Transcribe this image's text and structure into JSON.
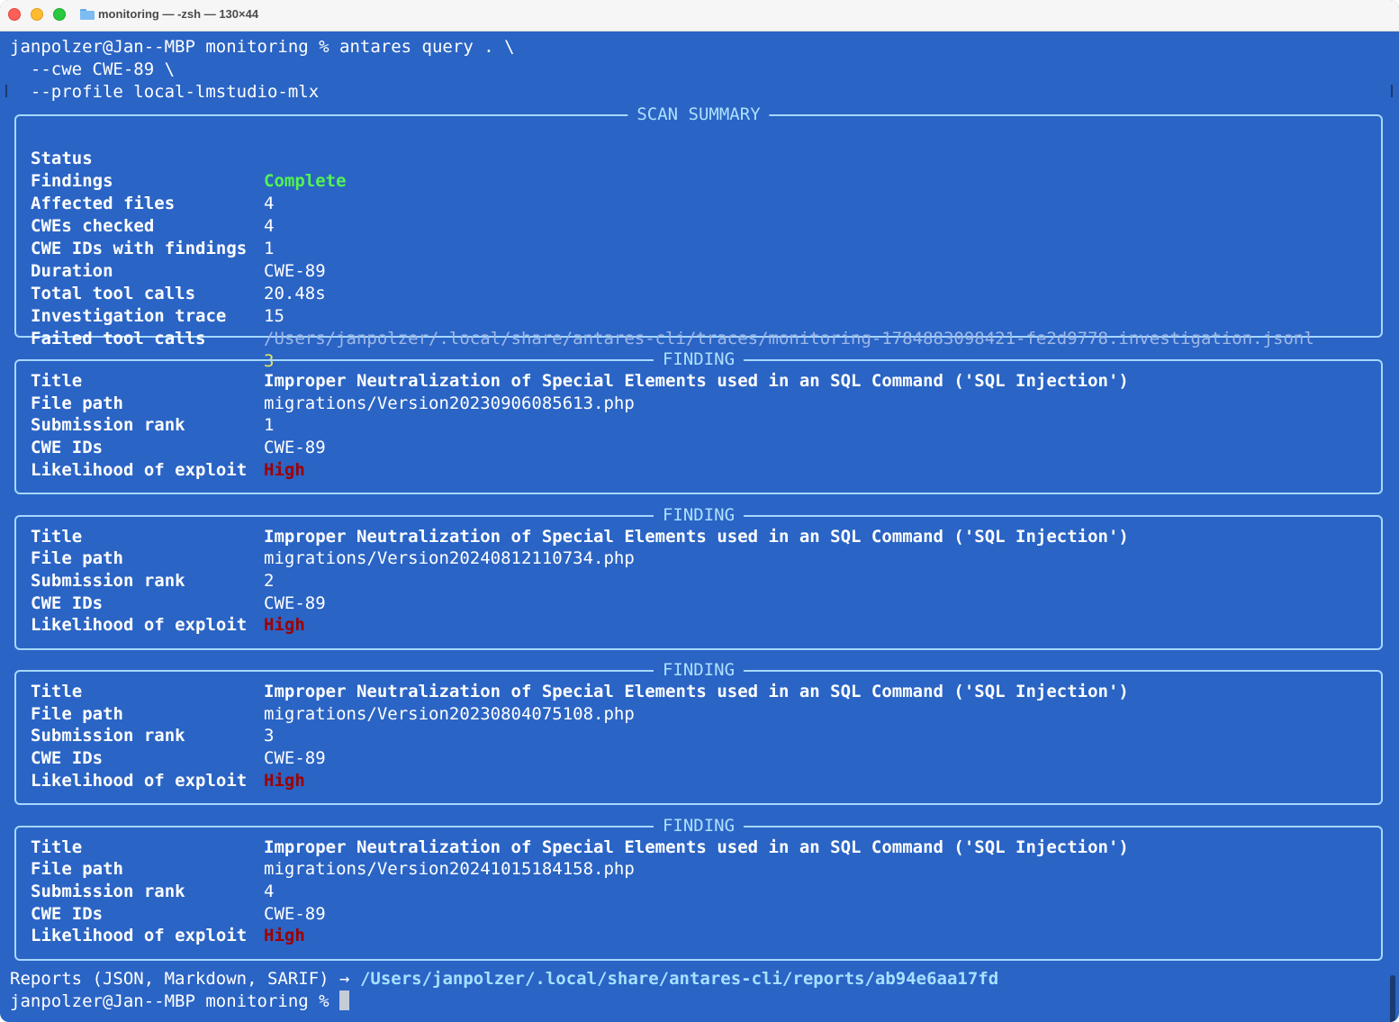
{
  "window": {
    "title": "monitoring — -zsh — 130×44"
  },
  "command": {
    "line1": "janpolzer@Jan--MBP monitoring % antares query . \\",
    "line2": "  --cwe CWE-89 \\",
    "line3": "  --profile local-lmstudio-mlx"
  },
  "summary": {
    "heading": "SCAN SUMMARY",
    "status_label": "Status",
    "status_value": "Complete",
    "findings_label": "Findings",
    "findings_value": "4",
    "affected_label": "Affected files",
    "affected_value": "4",
    "cwes_checked_label": "CWEs checked",
    "cwes_checked_value": "1",
    "cwe_ids_label": "CWE IDs with findings",
    "cwe_ids_value": "CWE-89",
    "duration_label": "Duration",
    "duration_value": "20.48s",
    "total_calls_label": "Total tool calls",
    "total_calls_value": "15",
    "trace_label": "Investigation trace",
    "trace_value": "/Users/janpolzer/.local/share/antares-cli/traces/monitoring-1784883098421-fe2d9778.investigation.jsonl",
    "failed_calls_label": "Failed tool calls",
    "failed_calls_value": "3"
  },
  "finding_labels": {
    "heading": "FINDING",
    "title": "Title",
    "file_path": "File path",
    "rank": "Submission rank",
    "cwe_ids": "CWE IDs",
    "likelihood": "Likelihood of exploit"
  },
  "findings": [
    {
      "title": "Improper Neutralization of Special Elements used in an SQL Command ('SQL Injection')",
      "file_path": "migrations/Version20230906085613.php",
      "rank": "1",
      "cwe_ids": "CWE-89",
      "likelihood": "High"
    },
    {
      "title": "Improper Neutralization of Special Elements used in an SQL Command ('SQL Injection')",
      "file_path": "migrations/Version20240812110734.php",
      "rank": "2",
      "cwe_ids": "CWE-89",
      "likelihood": "High"
    },
    {
      "title": "Improper Neutralization of Special Elements used in an SQL Command ('SQL Injection')",
      "file_path": "migrations/Version20230804075108.php",
      "rank": "3",
      "cwe_ids": "CWE-89",
      "likelihood": "High"
    },
    {
      "title": "Improper Neutralization of Special Elements used in an SQL Command ('SQL Injection')",
      "file_path": "migrations/Version20241015184158.php",
      "rank": "4",
      "cwe_ids": "CWE-89",
      "likelihood": "High"
    }
  ],
  "footer": {
    "reports_label": "Reports (JSON, Markdown, SARIF) → ",
    "reports_path": "/Users/janpolzer/.local/share/antares-cli/reports/ab94e6aa17fd",
    "prompt": "janpolzer@Jan--MBP monitoring % "
  },
  "colors": {
    "background": "#2a64c5",
    "status_complete": "#54f254",
    "likelihood_high": "#9c0000",
    "failed_calls": "#e8e85a",
    "panel_border": "#a7d8ff"
  }
}
